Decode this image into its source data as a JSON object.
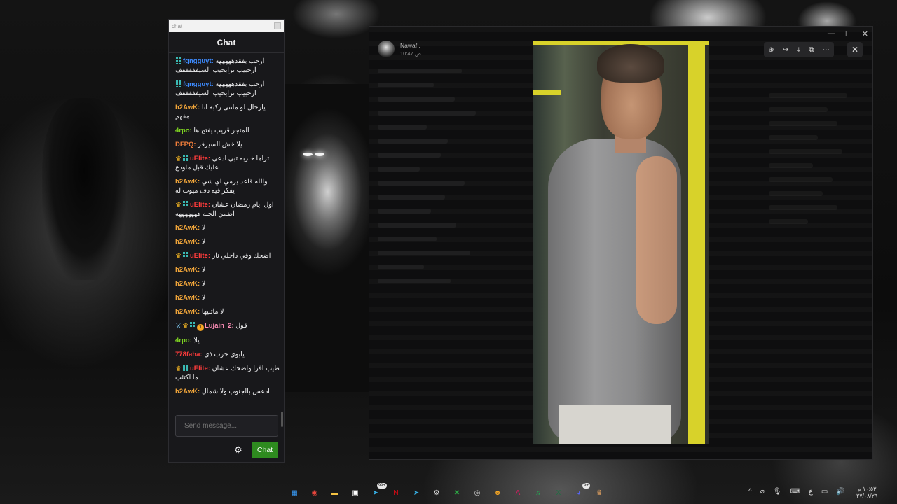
{
  "chat": {
    "titlebar": "chat",
    "header": "Chat",
    "messages": [
      {
        "user": "fgngguyt:",
        "user_color": "#3d8bff",
        "badges": [
          "grid"
        ],
        "text": "ارحب يفقدهههههه ارحبيب ترابحيب السيفففففف"
      },
      {
        "user": "fgngguyt:",
        "user_color": "#3d8bff",
        "badges": [
          "grid"
        ],
        "text": "ارحب يفقدهههههه ارحبيب ترابحيب السيفففففف"
      },
      {
        "user": "h2AwK:",
        "user_color": "#f2a63a",
        "badges": [],
        "text": "يارجال لو ماتنى ركبه انا مفهم"
      },
      {
        "user": "4rpo:",
        "user_color": "#7ed321",
        "badges": [],
        "text": "المتجر قريب يفتح ها"
      },
      {
        "user": "DFPQ:",
        "user_color": "#f07d3a",
        "badges": [],
        "text": "يلا خش السيرفر"
      },
      {
        "user": "uElite:",
        "user_color": "#ff3b3b",
        "badges": [
          "crown",
          "grid"
        ],
        "text": "تراها خاربه تبي ادعي عليك قبل ماودع"
      },
      {
        "user": "h2AwK:",
        "user_color": "#f2a63a",
        "badges": [],
        "text": "والله قاعد يرمي اي شي يفكر فيه دف ميوت له"
      },
      {
        "user": "uElite:",
        "user_color": "#ff3b3b",
        "badges": [
          "crown",
          "grid"
        ],
        "text": "اول ايام رمضان عشان اضمن الجنه هههههههه"
      },
      {
        "user": "h2AwK:",
        "user_color": "#f2a63a",
        "badges": [],
        "text": "لا"
      },
      {
        "user": "h2AwK:",
        "user_color": "#f2a63a",
        "badges": [],
        "text": "لا"
      },
      {
        "user": "uElite:",
        "user_color": "#ff3b3b",
        "badges": [
          "crown",
          "grid"
        ],
        "text": "اضحك وفي داخلي نار"
      },
      {
        "user": "h2AwK:",
        "user_color": "#f2a63a",
        "badges": [],
        "text": "لا"
      },
      {
        "user": "h2AwK:",
        "user_color": "#f2a63a",
        "badges": [],
        "text": "لا"
      },
      {
        "user": "h2AwK:",
        "user_color": "#f2a63a",
        "badges": [],
        "text": "لا"
      },
      {
        "user": "h2AwK:",
        "user_color": "#f2a63a",
        "badges": [],
        "text": "لا ماتبيها"
      },
      {
        "user": "Lujain_2:",
        "user_color": "#ff8fb8",
        "badges": [
          "sword",
          "crown",
          "grid",
          "one"
        ],
        "text": "قول"
      },
      {
        "user": "4rpo:",
        "user_color": "#7ed321",
        "badges": [],
        "text": "يلا"
      },
      {
        "user": "778faha:",
        "user_color": "#ff3b3b",
        "badges": [],
        "text": "يابوي حرب ذي"
      },
      {
        "user": "uElite:",
        "user_color": "#ff3b3b",
        "badges": [
          "crown",
          "grid"
        ],
        "text": "طيب اقرا واضحك عشان ما اكتئب"
      },
      {
        "user": "h2AwK:",
        "user_color": "#f2a63a",
        "badges": [],
        "text": "ادعس بالجنوب ولا شمال"
      }
    ],
    "input_placeholder": "Send message...",
    "send_label": "Chat",
    "settings_icon": "gear-icon"
  },
  "viewer": {
    "sender_name": "Nawaf .",
    "sender_time": "10:47 ص",
    "window_controls": [
      "—",
      "☐",
      "✕"
    ],
    "toolbar_icons": [
      "zoom-icon",
      "forward-icon",
      "download-icon",
      "open-external-icon",
      "more-icon"
    ],
    "close_icon": "close-icon"
  },
  "taskbar": {
    "icons": [
      {
        "name": "windows-start-icon",
        "color": "#3aa0ff",
        "glyph": "▦"
      },
      {
        "name": "chrome-icon",
        "color": "#e8453c",
        "glyph": "◉"
      },
      {
        "name": "file-explorer-icon",
        "color": "#f5c242",
        "glyph": "▬"
      },
      {
        "name": "store-icon",
        "color": "#ffffff",
        "glyph": "▣"
      },
      {
        "name": "telegram-icon",
        "color": "#37aee2",
        "glyph": "➤",
        "badge": "99+"
      },
      {
        "name": "netflix-icon",
        "color": "#e50914",
        "glyph": "N"
      },
      {
        "name": "telegram-alt-icon",
        "color": "#37aee2",
        "glyph": "➤"
      },
      {
        "name": "settings-icon",
        "color": "#dcdcdc",
        "glyph": "⚙"
      },
      {
        "name": "xbox-icon",
        "color": "#2ca243",
        "glyph": "✖"
      },
      {
        "name": "obs-icon",
        "color": "#dcdcdc",
        "glyph": "◎"
      },
      {
        "name": "discord-yellow-icon",
        "color": "#f5a623",
        "glyph": "☻"
      },
      {
        "name": "app-pink-icon",
        "color": "#d81b60",
        "glyph": "Λ"
      },
      {
        "name": "spotify-icon",
        "color": "#1db954",
        "glyph": "♫"
      },
      {
        "name": "excel-icon",
        "color": "#1d6f42",
        "glyph": "X"
      },
      {
        "name": "discord-icon",
        "color": "#5865f2",
        "glyph": "◕",
        "badge": "9+"
      },
      {
        "name": "game-icon",
        "color": "#e0a060",
        "glyph": "♛"
      }
    ],
    "tray": [
      "^",
      "⌀",
      "🎙",
      "⌨",
      "ع",
      "▭",
      "🔊"
    ],
    "clock_time": "١٠:٥٣ م",
    "clock_date": "٢٧/٠٨/٢٩"
  }
}
